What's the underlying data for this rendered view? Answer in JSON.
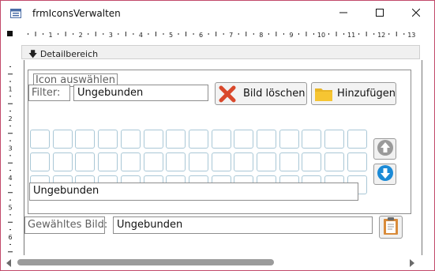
{
  "window": {
    "title": "frmIconsVerwalten"
  },
  "ruler": {
    "top_marks": [
      "1",
      "2",
      "3",
      "4",
      "5",
      "6",
      "7",
      "8",
      "9",
      "10",
      "11",
      "12",
      "13"
    ],
    "left_marks": [
      "1",
      "2",
      "3",
      "4",
      "5",
      "6"
    ]
  },
  "section": {
    "label": "Detailbereich"
  },
  "group": {
    "title": "Icon auswählen"
  },
  "filter": {
    "label": "Filter:",
    "value": "Ungebunden"
  },
  "buttons": {
    "delete_label": "Bild löschen",
    "add_label": "Hinzufügen"
  },
  "icon_grid": {
    "rows": 3,
    "cols": 15
  },
  "path_field": {
    "value": "Ungebunden"
  },
  "selected": {
    "label": "Gewähltes Bild:",
    "value": "Ungebunden"
  },
  "colors": {
    "window_border": "#c24a6a",
    "delete_x": "#d9482b",
    "folder": "#f6c532",
    "arrow_up": "#9a9a9a",
    "arrow_down": "#1b8ad6"
  },
  "icons": {
    "app": "form-icon",
    "minimize": "minimize-icon",
    "maximize": "maximize-icon",
    "close": "close-icon",
    "delete": "red-x-icon",
    "add": "folder-icon",
    "scroll_up": "arrow-up-circle-icon",
    "scroll_down": "arrow-down-circle-icon",
    "paste": "clipboard-icon"
  }
}
